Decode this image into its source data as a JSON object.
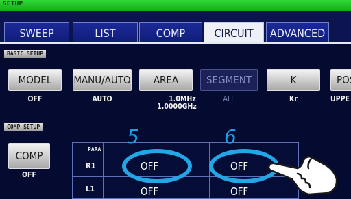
{
  "header": {
    "title": "SETUP"
  },
  "tabs": [
    {
      "label": "SWEEP"
    },
    {
      "label": "LIST"
    },
    {
      "label": "COMP"
    },
    {
      "label": "CIRCUIT"
    },
    {
      "label": "ADVANCED"
    }
  ],
  "active_tab": "CIRCUIT",
  "basic_setup": {
    "section_label": "BASIC SETUP",
    "buttons": [
      {
        "label": "MODEL",
        "value": "OFF"
      },
      {
        "label": "MANU/AUTO",
        "value": "AUTO"
      },
      {
        "label": "AREA",
        "value": "1.0MHz",
        "value2": "1.0000GHz"
      },
      {
        "label": "SEGMENT",
        "value": "ALL"
      },
      {
        "label": "K",
        "value": "Kr"
      },
      {
        "label": "POS",
        "value": "UPPE"
      }
    ]
  },
  "comp_setup": {
    "section_label": "COMP SETUP",
    "comp_button": {
      "label": "COMP",
      "value": "OFF"
    },
    "table": {
      "header": "PARA",
      "rows": [
        {
          "param": "R1",
          "col1": "OFF",
          "col2": "OFF"
        },
        {
          "param": "L1",
          "col1": "OFF",
          "col2": "OFF"
        }
      ]
    }
  },
  "annotations": {
    "step_a": "5",
    "step_b": "6"
  },
  "colors": {
    "accent_ring": "#22a6e6",
    "top_bar": "#22c02a",
    "background": "#040a30"
  }
}
